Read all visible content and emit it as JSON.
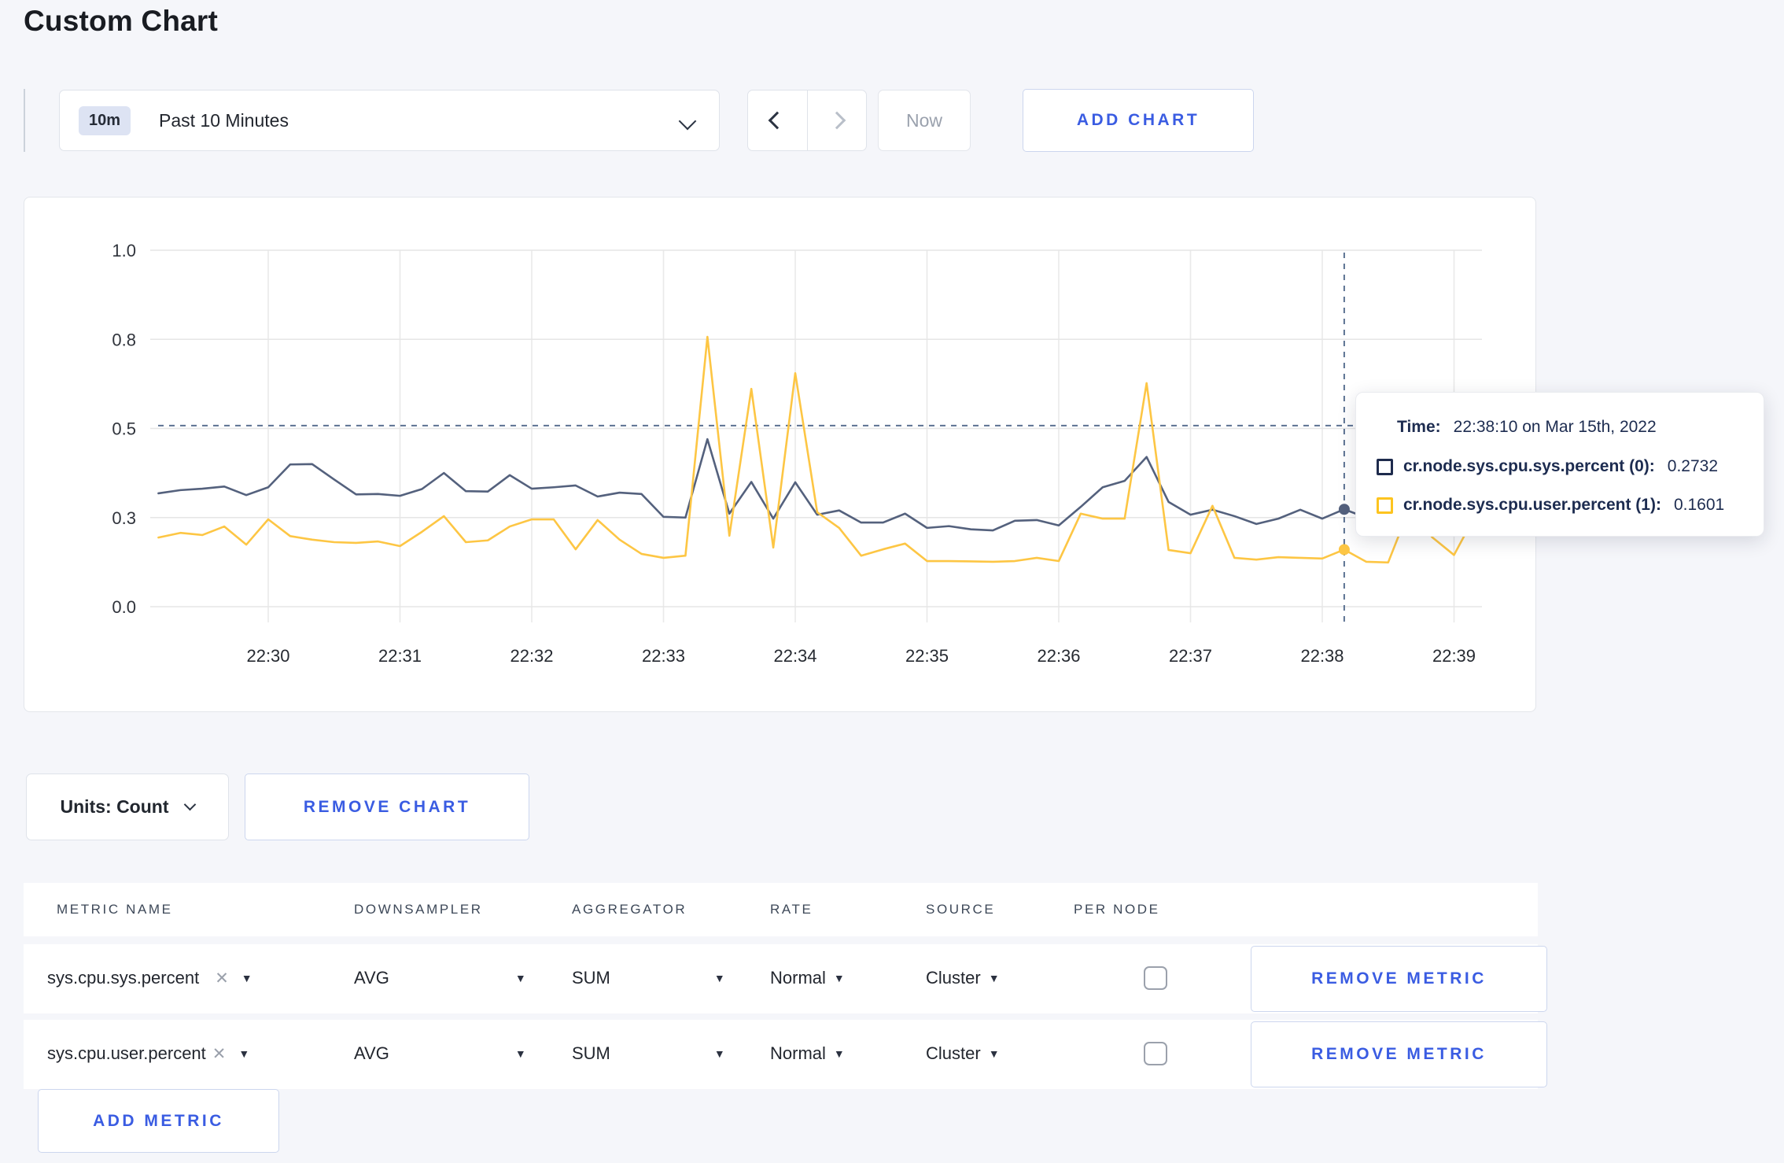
{
  "title": "Custom Chart",
  "colors": {
    "accent_blue": "#3a5ce2",
    "series_sys": "#54617d",
    "series_user": "#fdc644",
    "tooltip_navy": "#1d2c50",
    "crosshair": "#5c7292",
    "grid": "#e8e8e8",
    "disabled_text": "#9aa1ad"
  },
  "toolbar": {
    "range_badge": "10m",
    "range_label": "Past 10 Minutes",
    "now_label": "Now",
    "add_chart_label": "ADD CHART"
  },
  "chart_controls": {
    "units_label": "Units: Count",
    "remove_chart_label": "REMOVE CHART"
  },
  "tooltip": {
    "time_label": "Time:",
    "time_value": "22:38:10 on Mar 15th, 2022",
    "rows": [
      {
        "name": "cr.node.sys.cpu.sys.percent (0):",
        "value": "0.2732"
      },
      {
        "name": "cr.node.sys.cpu.user.percent (1):",
        "value": "0.1601"
      }
    ]
  },
  "chart_data": {
    "type": "line",
    "title": "",
    "xlabel": "",
    "ylabel": "",
    "ylim": [
      0,
      1.0
    ],
    "grid": true,
    "legend_position": "tooltip-only",
    "y_tick_labels": [
      "0.0",
      "0.3",
      "0.5",
      "0.8",
      "1.0"
    ],
    "y_tick_values": [
      0,
      0.25,
      0.5,
      0.75,
      1.0
    ],
    "x_tick_labels": [
      "22:30",
      "22:31",
      "22:32",
      "22:33",
      "22:34",
      "22:35",
      "22:36",
      "22:37",
      "22:38",
      "22:39"
    ],
    "x_tick_times_sec": [
      50,
      110,
      170,
      230,
      290,
      350,
      410,
      470,
      530,
      590
    ],
    "time_start_label": "22:29:10",
    "point_interval_sec": 10,
    "series": [
      {
        "name": "cr.node.sys.cpu.sys.percent",
        "color": "#54617d",
        "values": [
          0.318,
          0.327,
          0.331,
          0.337,
          0.313,
          0.335,
          0.399,
          0.4,
          0.357,
          0.315,
          0.316,
          0.311,
          0.33,
          0.375,
          0.324,
          0.323,
          0.369,
          0.331,
          0.335,
          0.34,
          0.309,
          0.32,
          0.316,
          0.252,
          0.25,
          0.47,
          0.261,
          0.35,
          0.247,
          0.349,
          0.258,
          0.27,
          0.236,
          0.236,
          0.261,
          0.221,
          0.226,
          0.217,
          0.214,
          0.241,
          0.243,
          0.228,
          0.28,
          0.335,
          0.353,
          0.42,
          0.294,
          0.258,
          0.272,
          0.254,
          0.232,
          0.247,
          0.272,
          0.247,
          0.2732,
          0.25,
          0.255,
          0.3,
          0.29,
          0.28,
          0.3
        ]
      },
      {
        "name": "cr.node.sys.cpu.user.percent",
        "color": "#fdc644",
        "values": [
          0.194,
          0.207,
          0.201,
          0.225,
          0.174,
          0.245,
          0.198,
          0.188,
          0.181,
          0.179,
          0.183,
          0.17,
          0.21,
          0.254,
          0.181,
          0.186,
          0.225,
          0.245,
          0.245,
          0.161,
          0.243,
          0.188,
          0.148,
          0.137,
          0.143,
          0.757,
          0.199,
          0.611,
          0.166,
          0.655,
          0.265,
          0.221,
          0.143,
          0.161,
          0.177,
          0.128,
          0.128,
          0.127,
          0.126,
          0.128,
          0.137,
          0.128,
          0.261,
          0.247,
          0.247,
          0.627,
          0.159,
          0.15,
          0.283,
          0.137,
          0.132,
          0.139,
          0.137,
          0.135,
          0.1601,
          0.126,
          0.124,
          0.28,
          0.195,
          0.145,
          0.26
        ]
      }
    ],
    "crosshair": {
      "time_sec": 540,
      "time_label": "22:38:10",
      "h_line_value": 0.508,
      "points": [
        {
          "series": 0,
          "value": 0.2732
        },
        {
          "series": 1,
          "value": 0.1601
        }
      ]
    }
  },
  "metrics_table": {
    "headers": [
      "METRIC NAME",
      "DOWNSAMPLER",
      "AGGREGATOR",
      "RATE",
      "SOURCE",
      "PER NODE"
    ],
    "rows": [
      {
        "metric": "sys.cpu.sys.percent",
        "remove_x": "✕",
        "downsampler": "AVG",
        "aggregator": "SUM",
        "rate": "Normal",
        "source": "Cluster",
        "per_node_checked": false,
        "remove_label": "REMOVE METRIC"
      },
      {
        "metric": "sys.cpu.user.percent",
        "remove_x": "✕",
        "downsampler": "AVG",
        "aggregator": "SUM",
        "rate": "Normal",
        "source": "Cluster",
        "per_node_checked": false,
        "remove_label": "REMOVE METRIC"
      }
    ],
    "add_metric_label": "ADD METRIC"
  }
}
